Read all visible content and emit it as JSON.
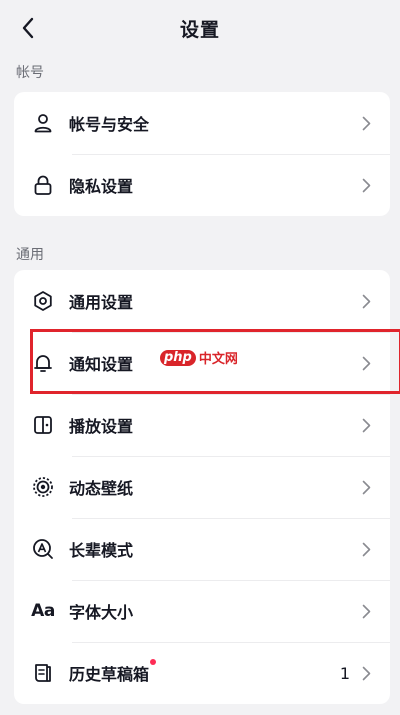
{
  "header": {
    "title": "设置"
  },
  "sections": [
    {
      "label": "帐号",
      "items": [
        {
          "label": "帐号与安全",
          "icon": "person-icon"
        },
        {
          "label": "隐私设置",
          "icon": "lock-icon"
        }
      ]
    },
    {
      "label": "通用",
      "items": [
        {
          "label": "通用设置",
          "icon": "gear-icon"
        },
        {
          "label": "通知设置",
          "icon": "bell-icon"
        },
        {
          "label": "播放设置",
          "icon": "play-settings-icon"
        },
        {
          "label": "动态壁纸",
          "icon": "wallpaper-icon"
        },
        {
          "label": "长辈模式",
          "icon": "elder-mode-icon"
        },
        {
          "label": "字体大小",
          "icon": "font-size-icon",
          "icon_text": "Aa"
        },
        {
          "label": "历史草稿箱",
          "icon": "drafts-icon",
          "count": "1",
          "has_badge": true
        }
      ]
    }
  ],
  "watermark": {
    "badge": "php",
    "text": "中文网"
  },
  "colors": {
    "accent_red": "#fe2c55",
    "highlight": "#e0242c",
    "background": "#f2f2f4"
  }
}
